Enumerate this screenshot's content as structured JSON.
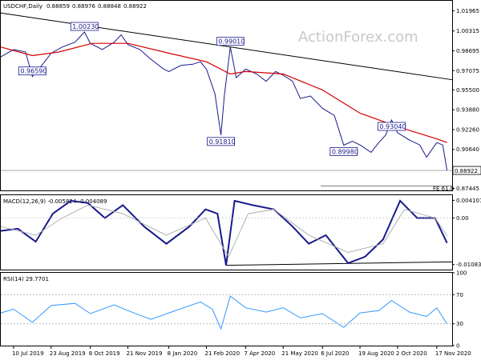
{
  "chart_data": [
    {
      "type": "line",
      "panel": "price",
      "title": "USDCHF,Daily",
      "ohlc": [
        "0.88859",
        "0.88976",
        "0.88848",
        "0.88922"
      ],
      "ylim": [
        0.8729,
        1.0278
      ],
      "y_ticks": [
        "1.01965",
        "1.00315",
        "0.98695",
        "0.97075",
        "0.95500",
        "0.93880",
        "0.92260",
        "0.90640",
        "0.89015",
        "0.87445"
      ],
      "x_ticks": [
        "10 Jul 2019",
        "23 Aug 2019",
        "8 Oct 2019",
        "21 Nov 2019",
        "8 Jan 2020",
        "21 Feb 2020",
        "7 Apr 2020",
        "21 May 2020",
        "6 Jul 2020",
        "19 Aug 2020",
        "2 Oct 2020",
        "17 Nov 2020"
      ],
      "x_tick_dates": [
        "2019-07-10",
        "2019-08-23",
        "2019-10-08",
        "2019-11-21",
        "2020-01-08",
        "2020-02-21",
        "2020-04-07",
        "2020-05-21",
        "2020-07-06",
        "2020-08-19",
        "2020-10-02",
        "2020-11-17"
      ],
      "xlim": [
        "2019-06-25",
        "2020-12-05"
      ],
      "series": [
        {
          "values": [
            {
              "d": "2019-06-25",
              "v": 0.982
            },
            {
              "d": "2019-07-10",
              "v": 0.988
            },
            {
              "d": "2019-07-24",
              "v": 0.986
            },
            {
              "d": "2019-08-01",
              "v": 0.9659
            },
            {
              "d": "2019-08-12",
              "v": 0.975
            },
            {
              "d": "2019-08-23",
              "v": 0.985
            },
            {
              "d": "2019-09-05",
              "v": 0.99
            },
            {
              "d": "2019-09-20",
              "v": 0.994
            },
            {
              "d": "2019-10-01",
              "v": 1.0023
            },
            {
              "d": "2019-10-08",
              "v": 0.993
            },
            {
              "d": "2019-10-22",
              "v": 0.988
            },
            {
              "d": "2019-11-05",
              "v": 0.994
            },
            {
              "d": "2019-11-13",
              "v": 1.0
            },
            {
              "d": "2019-11-21",
              "v": 0.992
            },
            {
              "d": "2019-12-05",
              "v": 0.988
            },
            {
              "d": "2019-12-18",
              "v": 0.98
            },
            {
              "d": "2020-01-02",
              "v": 0.972
            },
            {
              "d": "2020-01-08",
              "v": 0.97
            },
            {
              "d": "2020-01-22",
              "v": 0.975
            },
            {
              "d": "2020-02-05",
              "v": 0.976
            },
            {
              "d": "2020-02-14",
              "v": 0.978
            },
            {
              "d": "2020-02-21",
              "v": 0.972
            },
            {
              "d": "2020-03-02",
              "v": 0.952
            },
            {
              "d": "2020-03-09",
              "v": 0.9181
            },
            {
              "d": "2020-03-13",
              "v": 0.95
            },
            {
              "d": "2020-03-20",
              "v": 0.9901
            },
            {
              "d": "2020-03-27",
              "v": 0.965
            },
            {
              "d": "2020-04-07",
              "v": 0.972
            },
            {
              "d": "2020-04-20",
              "v": 0.968
            },
            {
              "d": "2020-05-01",
              "v": 0.962
            },
            {
              "d": "2020-05-12",
              "v": 0.97
            },
            {
              "d": "2020-05-21",
              "v": 0.967
            },
            {
              "d": "2020-06-01",
              "v": 0.962
            },
            {
              "d": "2020-06-10",
              "v": 0.948
            },
            {
              "d": "2020-06-22",
              "v": 0.95
            },
            {
              "d": "2020-07-06",
              "v": 0.94
            },
            {
              "d": "2020-07-20",
              "v": 0.934
            },
            {
              "d": "2020-07-31",
              "v": 0.9098
            },
            {
              "d": "2020-08-10",
              "v": 0.913
            },
            {
              "d": "2020-08-19",
              "v": 0.91
            },
            {
              "d": "2020-09-01",
              "v": 0.904
            },
            {
              "d": "2020-09-10",
              "v": 0.912
            },
            {
              "d": "2020-09-18",
              "v": 0.918
            },
            {
              "d": "2020-09-25",
              "v": 0.9304
            },
            {
              "d": "2020-10-02",
              "v": 0.92
            },
            {
              "d": "2020-10-16",
              "v": 0.914
            },
            {
              "d": "2020-10-28",
              "v": 0.91
            },
            {
              "d": "2020-11-05",
              "v": 0.9
            },
            {
              "d": "2020-11-17",
              "v": 0.912
            },
            {
              "d": "2020-11-24",
              "v": 0.91
            },
            {
              "d": "2020-11-29",
              "v": 0.8892
            }
          ]
        },
        {
          "role": "moving average",
          "color": "#d40000",
          "values": [
            {
              "d": "2019-06-25",
              "v": 0.99
            },
            {
              "d": "2019-08-01",
              "v": 0.983
            },
            {
              "d": "2019-09-01",
              "v": 0.986
            },
            {
              "d": "2019-10-10",
              "v": 0.993
            },
            {
              "d": "2019-11-21",
              "v": 0.993
            },
            {
              "d": "2020-01-08",
              "v": 0.985
            },
            {
              "d": "2020-02-21",
              "v": 0.978
            },
            {
              "d": "2020-03-20",
              "v": 0.968
            },
            {
              "d": "2020-04-07",
              "v": 0.97
            },
            {
              "d": "2020-05-21",
              "v": 0.968
            },
            {
              "d": "2020-07-06",
              "v": 0.955
            },
            {
              "d": "2020-08-19",
              "v": 0.936
            },
            {
              "d": "2020-10-02",
              "v": 0.925
            },
            {
              "d": "2020-11-17",
              "v": 0.915
            },
            {
              "d": "2020-11-29",
              "v": 0.912
            }
          ]
        }
      ],
      "annotations": [
        {
          "d": "2019-08-01",
          "v": 0.9659,
          "text": "0.96590"
        },
        {
          "d": "2019-10-01",
          "v": 1.0023,
          "text": "1.00230"
        },
        {
          "d": "2020-03-09",
          "v": 0.9181,
          "text": "0.91810"
        },
        {
          "d": "2020-03-20",
          "v": 0.9901,
          "text": "0.99010"
        },
        {
          "d": "2020-07-31",
          "v": 0.9098,
          "text": "0.89980"
        },
        {
          "d": "2020-09-25",
          "v": 0.9304,
          "text": "0.93040"
        }
      ],
      "trendline": [
        {
          "d": "2019-06-25",
          "v": 1.0178
        },
        {
          "d": "2020-12-05",
          "v": 0.9633
        }
      ],
      "fe_label": "FE 61.8",
      "fe_level": 0.8764,
      "last_price_label": "0.88922",
      "last_price": 0.88922
    },
    {
      "type": "line",
      "panel": "macd",
      "title": "MACD(12,26,9) -0.005824 -0.004089",
      "ylim": [
        -0.012,
        0.0053
      ],
      "y_ticks": [
        "0.004101",
        "0.00",
        "-0.010833"
      ],
      "series": [
        {
          "role": "macd",
          "color": "#1a1a8c",
          "values": [
            {
              "d": "2019-06-25",
              "v": -0.003
            },
            {
              "d": "2019-07-15",
              "v": -0.0025
            },
            {
              "d": "2019-08-05",
              "v": -0.0055
            },
            {
              "d": "2019-08-25",
              "v": 0.001
            },
            {
              "d": "2019-09-15",
              "v": 0.004
            },
            {
              "d": "2019-10-05",
              "v": 0.0035
            },
            {
              "d": "2019-10-25",
              "v": 0.0
            },
            {
              "d": "2019-11-15",
              "v": 0.003
            },
            {
              "d": "2019-12-10",
              "v": -0.002
            },
            {
              "d": "2020-01-05",
              "v": -0.006
            },
            {
              "d": "2020-02-01",
              "v": -0.002
            },
            {
              "d": "2020-02-20",
              "v": 0.002
            },
            {
              "d": "2020-03-05",
              "v": 0.001
            },
            {
              "d": "2020-03-15",
              "v": -0.011
            },
            {
              "d": "2020-03-25",
              "v": 0.004
            },
            {
              "d": "2020-04-15",
              "v": 0.003
            },
            {
              "d": "2020-05-10",
              "v": 0.002
            },
            {
              "d": "2020-06-01",
              "v": -0.002
            },
            {
              "d": "2020-06-20",
              "v": -0.006
            },
            {
              "d": "2020-07-10",
              "v": -0.004
            },
            {
              "d": "2020-08-05",
              "v": -0.0105
            },
            {
              "d": "2020-08-25",
              "v": -0.009
            },
            {
              "d": "2020-09-15",
              "v": -0.005
            },
            {
              "d": "2020-10-05",
              "v": 0.004
            },
            {
              "d": "2020-10-25",
              "v": 0.0
            },
            {
              "d": "2020-11-15",
              "v": 0.0
            },
            {
              "d": "2020-11-29",
              "v": -0.0058
            }
          ]
        },
        {
          "role": "signal",
          "color": "#b0b0b0",
          "values": [
            {
              "d": "2019-06-25",
              "v": -0.002
            },
            {
              "d": "2019-08-05",
              "v": -0.004
            },
            {
              "d": "2019-09-05",
              "v": 0.0
            },
            {
              "d": "2019-10-05",
              "v": 0.003
            },
            {
              "d": "2019-11-15",
              "v": 0.001
            },
            {
              "d": "2020-01-05",
              "v": -0.004
            },
            {
              "d": "2020-02-20",
              "v": 0.0
            },
            {
              "d": "2020-03-18",
              "v": -0.009
            },
            {
              "d": "2020-04-10",
              "v": 0.001
            },
            {
              "d": "2020-05-10",
              "v": 0.002
            },
            {
              "d": "2020-06-20",
              "v": -0.004
            },
            {
              "d": "2020-08-05",
              "v": -0.008
            },
            {
              "d": "2020-09-15",
              "v": -0.006
            },
            {
              "d": "2020-10-10",
              "v": 0.002
            },
            {
              "d": "2020-11-15",
              "v": 0.0
            },
            {
              "d": "2020-11-29",
              "v": -0.0041
            }
          ]
        }
      ],
      "trendline": [
        {
          "d": "2020-03-15",
          "v": -0.011
        },
        {
          "d": "2020-12-05",
          "v": -0.0102
        }
      ]
    },
    {
      "type": "line",
      "panel": "rsi",
      "title": "RSI(14) 29.7701",
      "ylim": [
        0,
        100
      ],
      "y_ticks": [
        "100",
        "70",
        "30",
        "0"
      ],
      "series": [
        {
          "role": "rsi",
          "color": "#3399ff",
          "values": [
            {
              "d": "2019-06-25",
              "v": 45
            },
            {
              "d": "2019-07-10",
              "v": 50
            },
            {
              "d": "2019-08-01",
              "v": 32
            },
            {
              "d": "2019-08-23",
              "v": 55
            },
            {
              "d": "2019-09-20",
              "v": 58
            },
            {
              "d": "2019-10-08",
              "v": 44
            },
            {
              "d": "2019-11-05",
              "v": 56
            },
            {
              "d": "2019-11-21",
              "v": 48
            },
            {
              "d": "2019-12-18",
              "v": 36
            },
            {
              "d": "2020-01-08",
              "v": 45
            },
            {
              "d": "2020-02-14",
              "v": 60
            },
            {
              "d": "2020-02-28",
              "v": 50
            },
            {
              "d": "2020-03-09",
              "v": 23
            },
            {
              "d": "2020-03-20",
              "v": 68
            },
            {
              "d": "2020-04-07",
              "v": 52
            },
            {
              "d": "2020-05-01",
              "v": 46
            },
            {
              "d": "2020-05-21",
              "v": 52
            },
            {
              "d": "2020-06-10",
              "v": 38
            },
            {
              "d": "2020-07-06",
              "v": 44
            },
            {
              "d": "2020-07-31",
              "v": 25
            },
            {
              "d": "2020-08-19",
              "v": 45
            },
            {
              "d": "2020-09-10",
              "v": 48
            },
            {
              "d": "2020-09-25",
              "v": 62
            },
            {
              "d": "2020-10-16",
              "v": 46
            },
            {
              "d": "2020-11-05",
              "v": 40
            },
            {
              "d": "2020-11-17",
              "v": 52
            },
            {
              "d": "2020-11-29",
              "v": 29.77
            }
          ]
        }
      ]
    }
  ],
  "watermark": "ActionForex.com"
}
